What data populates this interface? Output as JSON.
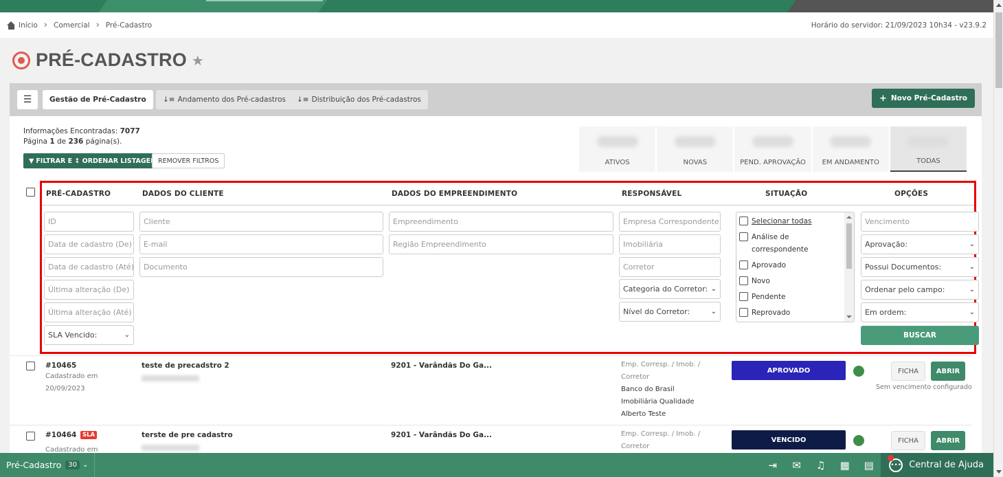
{
  "breadcrumb": {
    "items": [
      "Início",
      "Comercial",
      "Pré-Cadastro"
    ]
  },
  "server_time": "Horário do servidor: 21/09/2023 10h34 - v23.9.2",
  "page": {
    "title": "PRÉ-CADASTRO"
  },
  "toolbar": {
    "tabs": [
      "Gestão de Pré-Cadastro",
      "Andamento dos Pré-cadastros",
      "Distribuição dos Pré-cadastros"
    ],
    "new_button": "Novo Pré-Cadastro"
  },
  "info": {
    "found_label": "Informações Encontradas:",
    "found_count": "7077",
    "page_word": "Página",
    "page_num": "1",
    "of_word": "de",
    "total_pages": "236",
    "pages_suffix": "página(s).",
    "filter_button": "FILTRAR E ↕ ORDENAR LISTAGEM",
    "remove_button": "REMOVER FILTROS"
  },
  "stats": [
    "ATIVOS",
    "NOVAS",
    "PEND. APROVAÇÃO",
    "EM ANDAMENTO",
    "TODAS"
  ],
  "columns": [
    "PRÉ-CADASTRO",
    "DADOS DO CLIENTE",
    "DADOS DO EMPREENDIMENTO",
    "RESPONSÁVEL",
    "SITUAÇÃO",
    "OPÇÕES"
  ],
  "filters": {
    "precadastro": [
      "ID",
      "Data de cadastro (De)",
      "Data de cadastro (Até)",
      "Última alteração (De)",
      "Última alteração (Até)"
    ],
    "sla_select": "SLA Vencido:",
    "cliente": [
      "Cliente",
      "E-mail",
      "Documento"
    ],
    "empreendimento": [
      "Empreendimento",
      "Região Empreendimento"
    ],
    "responsavel": [
      "Empresa Correspondente",
      "Imobiliária",
      "Corretor"
    ],
    "responsavel_selects": [
      "Categoria do Corretor:",
      "Nível do Corretor:"
    ],
    "situacao": [
      "Selecionar todas",
      "Análise de correspondente",
      "Aprovado",
      "Novo",
      "Pendente",
      "Reprovado"
    ],
    "opcoes_input": "Vencimento",
    "opcoes_selects": [
      "Aprovação:",
      "Possui Documentos:",
      "Ordenar pelo campo:",
      "Em ordem:"
    ],
    "search_button": "BUSCAR"
  },
  "rows": [
    {
      "id": "#10465",
      "sub1": "Cadastrado em",
      "sub2": "20/09/2023",
      "sla": "",
      "client": "teste de precadstro 2",
      "emp": "9201 - Varândãs Do Ga...",
      "resp_label1": "Emp. Corresp. / Imob. /",
      "resp_label2": "Corretor",
      "resp_values": [
        "Banco do Brasil",
        "Imobiliária Qualidade",
        "Alberto Teste"
      ],
      "status": "APROVADO",
      "status_color": "#2a24b8",
      "ficha": "FICHA",
      "abrir": "ABRIR",
      "note": "Sem vencimento configurado"
    },
    {
      "id": "#10464",
      "sub1": "Cadastrado em",
      "sub2": "",
      "sla": "SLA",
      "client": "terste de pre cadastro",
      "emp": "9201 - Varândãs Do Ga...",
      "resp_label1": "Emp. Corresp. / Imob. /",
      "resp_label2": "Corretor",
      "resp_values": [],
      "status": "VENCIDO",
      "status_color": "#0f1b47",
      "ficha": "FICHA",
      "abrir": "ABRIR",
      "note": ""
    }
  ],
  "bottombar": {
    "module": "Pré-Cadastro",
    "count": "30",
    "help": "Central de Ajuda"
  },
  "colors": {
    "primary": "#3f8a68",
    "dark": "#2f6e57",
    "highlight": "#e60000"
  }
}
